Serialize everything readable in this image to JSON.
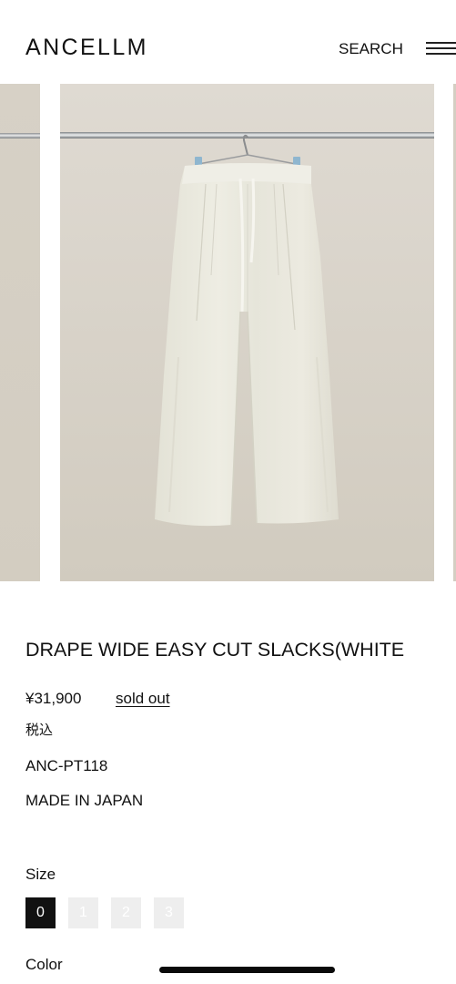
{
  "header": {
    "logo": "ANCELLM",
    "search_label": "SEARCH",
    "menu_icon": "hamburger-menu-icon"
  },
  "gallery": {
    "main_image_alt": "DRAPE WIDE EASY CUT SLACKS(WHITE) product photo",
    "background_color": "#d8d3ca"
  },
  "product": {
    "title": "DRAPE WIDE EASY CUT SLACKS(WHITE",
    "price": "¥31,900",
    "stock_status": "sold out",
    "tax_note": "税込",
    "sku": "ANC-PT118",
    "origin": "MADE IN JAPAN"
  },
  "size": {
    "label": "Size",
    "options": [
      "0",
      "1",
      "2",
      "3"
    ],
    "selected": "0"
  },
  "color": {
    "label": "Color"
  },
  "colors": {
    "text": "#111111",
    "chip_selected": "#111111",
    "chip_unavailable": "#eeeeee"
  }
}
